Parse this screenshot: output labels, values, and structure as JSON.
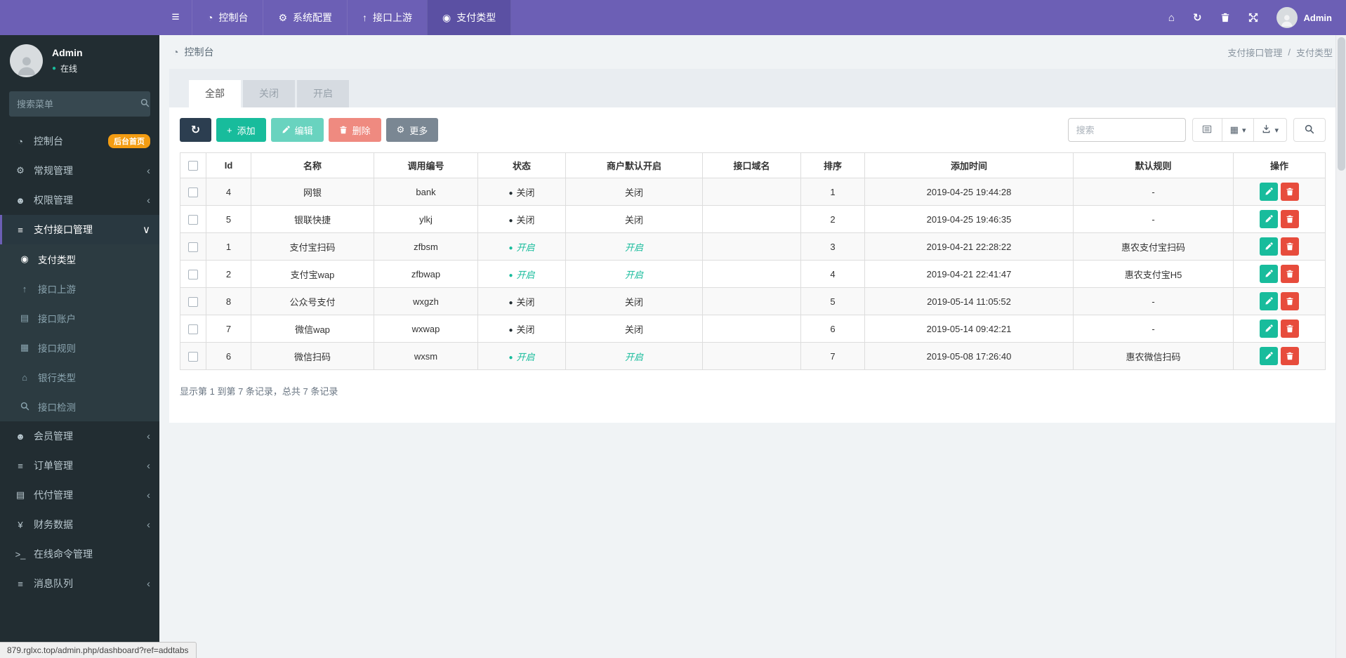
{
  "icons": {
    "hamburger": "≡",
    "dashboard": "◔",
    "gear": "⚙",
    "arrow-up": "↑",
    "pay-circle": "◉",
    "home": "⌂",
    "refresh": "↻",
    "caret-down": "▾",
    "chevron-left": "‹",
    "chevron-down": "∨",
    "users": "☻",
    "list": "≡",
    "address-book": "▤",
    "grid": "▦",
    "bank": "⌂",
    "yen": "¥",
    "terminal": ">_",
    "card": "▤",
    "dot": "●",
    "plus": "+",
    "slash": "/"
  },
  "colors": {
    "accent": "#6c5fb5",
    "accent_dark": "#5b50a3",
    "success": "#18bc9c",
    "danger": "#e74c3c",
    "dark": "#2c3e50",
    "warning": "#f39c12",
    "sidebar": "#222d32",
    "submenu": "#2c3b41"
  },
  "navbar": {
    "menu": [
      {
        "key": "dashboard",
        "label": "控制台",
        "icon": "dashboard",
        "active": false
      },
      {
        "key": "system-config",
        "label": "系统配置",
        "icon": "gear",
        "active": false
      },
      {
        "key": "interface-upstream",
        "label": "接口上游",
        "icon": "arrow-up",
        "active": false
      },
      {
        "key": "pay-type",
        "label": "支付类型",
        "icon": "pay-circle",
        "active": true
      }
    ],
    "user_label": "Admin"
  },
  "sidebar": {
    "user": {
      "name": "Admin",
      "status": "在线"
    },
    "search_placeholder": "搜索菜单",
    "menu": [
      {
        "key": "dashboard",
        "label": "控制台",
        "icon": "dashboard",
        "badge": "后台首页"
      },
      {
        "key": "general",
        "label": "常规管理",
        "icon": "gear",
        "chevron": "left"
      },
      {
        "key": "auth",
        "label": "权限管理",
        "icon": "users",
        "chevron": "left"
      },
      {
        "key": "payment-interface",
        "label": "支付接口管理",
        "icon": "list",
        "chevron": "down",
        "active": true,
        "children": [
          {
            "key": "pay-type",
            "label": "支付类型",
            "icon": "pay-circle",
            "active": true
          },
          {
            "key": "interface-upstream",
            "label": "接口上游",
            "icon": "arrow-up"
          },
          {
            "key": "interface-account",
            "label": "接口账户",
            "icon": "address-book"
          },
          {
            "key": "interface-rule",
            "label": "接口规则",
            "icon": "grid"
          },
          {
            "key": "bank-type",
            "label": "银行类型",
            "icon": "bank"
          },
          {
            "key": "interface-check",
            "label": "接口检测",
            "icon": "svg:search"
          }
        ]
      },
      {
        "key": "member",
        "label": "会员管理",
        "icon": "users",
        "chevron": "left"
      },
      {
        "key": "order",
        "label": "订单管理",
        "icon": "list",
        "chevron": "left"
      },
      {
        "key": "payout",
        "label": "代付管理",
        "icon": "card",
        "chevron": "left"
      },
      {
        "key": "finance",
        "label": "财务数据",
        "icon": "yen",
        "chevron": "left"
      },
      {
        "key": "online-command",
        "label": "在线命令管理",
        "icon": "terminal"
      },
      {
        "key": "message-queue",
        "label": "消息队列",
        "icon": "list",
        "chevron": "left"
      }
    ]
  },
  "breadcrumb": {
    "left": "控制台",
    "right": [
      "支付接口管理",
      "支付类型"
    ],
    "separator": "/"
  },
  "tabs": [
    {
      "key": "all",
      "label": "全部",
      "active": true
    },
    {
      "key": "closed",
      "label": "关闭",
      "active": false
    },
    {
      "key": "open",
      "label": "开启",
      "active": false
    }
  ],
  "toolbar": {
    "add_label": "添加",
    "edit_label": "编辑",
    "delete_label": "删除",
    "more_label": "更多",
    "search_placeholder": "搜索"
  },
  "table": {
    "headers": [
      "Id",
      "名称",
      "调用编号",
      "状态",
      "商户默认开启",
      "接口域名",
      "排序",
      "添加时间",
      "默认规则",
      "操作"
    ],
    "status_on": "开启",
    "status_off": "关闭",
    "rows": [
      {
        "id": "4",
        "name": "网银",
        "code": "bank",
        "status": "关闭",
        "merchant": "关闭",
        "domain": "",
        "sort": "1",
        "time": "2019-04-25 19:44:28",
        "rule": "-"
      },
      {
        "id": "5",
        "name": "银联快捷",
        "code": "ylkj",
        "status": "关闭",
        "merchant": "关闭",
        "domain": "",
        "sort": "2",
        "time": "2019-04-25 19:46:35",
        "rule": "-"
      },
      {
        "id": "1",
        "name": "支付宝扫码",
        "code": "zfbsm",
        "status": "开启",
        "merchant": "开启",
        "domain": "",
        "sort": "3",
        "time": "2019-04-21 22:28:22",
        "rule": "惠农支付宝扫码"
      },
      {
        "id": "2",
        "name": "支付宝wap",
        "code": "zfbwap",
        "status": "开启",
        "merchant": "开启",
        "domain": "",
        "sort": "4",
        "time": "2019-04-21 22:41:47",
        "rule": "惠农支付宝H5"
      },
      {
        "id": "8",
        "name": "公众号支付",
        "code": "wxgzh",
        "status": "关闭",
        "merchant": "关闭",
        "domain": "",
        "sort": "5",
        "time": "2019-05-14 11:05:52",
        "rule": "-"
      },
      {
        "id": "7",
        "name": "微信wap",
        "code": "wxwap",
        "status": "关闭",
        "merchant": "关闭",
        "domain": "",
        "sort": "6",
        "time": "2019-05-14 09:42:21",
        "rule": "-"
      },
      {
        "id": "6",
        "name": "微信扫码",
        "code": "wxsm",
        "status": "开启",
        "merchant": "开启",
        "domain": "",
        "sort": "7",
        "time": "2019-05-08 17:26:40",
        "rule": "惠农微信扫码"
      }
    ]
  },
  "summary": "显示第 1 到第 7 条记录，总共 7 条记录",
  "statusbar": "879.rglxc.top/admin.php/dashboard?ref=addtabs"
}
